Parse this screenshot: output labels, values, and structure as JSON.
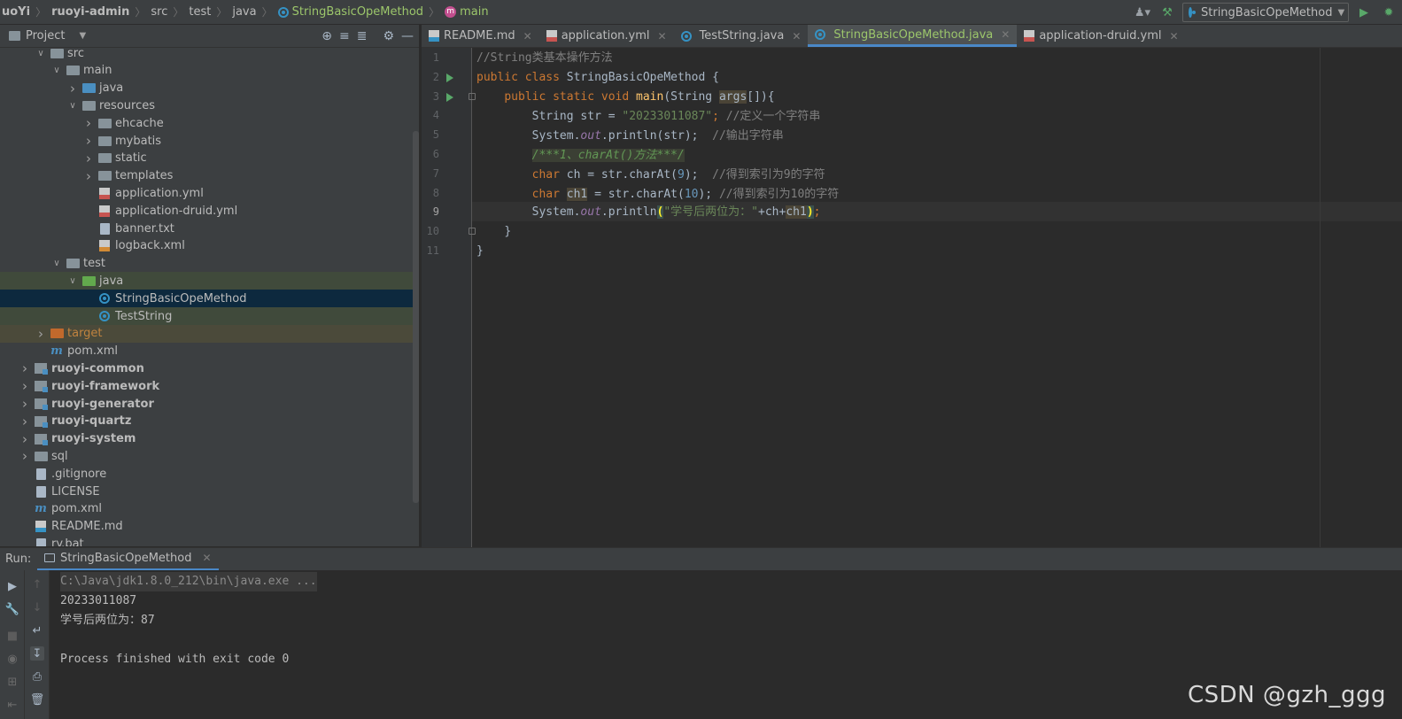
{
  "breadcrumb": {
    "items": [
      "uoYi",
      "ruoyi-admin",
      "src",
      "test",
      "java",
      "StringBasicOpeMethod",
      "main"
    ]
  },
  "toolbar": {
    "run_config": "StringBasicOpeMethod",
    "icons": [
      "user-icon",
      "hammer-icon",
      "run-icon",
      "debug-icon"
    ]
  },
  "project_panel": {
    "title": "Project",
    "tree": [
      {
        "label": "src",
        "depth": 2,
        "expanded": true,
        "icon": "folder"
      },
      {
        "label": "main",
        "depth": 3,
        "expanded": true,
        "icon": "folder"
      },
      {
        "label": "java",
        "depth": 4,
        "expanded": false,
        "icon": "folder-blue"
      },
      {
        "label": "resources",
        "depth": 4,
        "expanded": true,
        "icon": "folder-resources"
      },
      {
        "label": "ehcache",
        "depth": 5,
        "expanded": false,
        "icon": "folder"
      },
      {
        "label": "mybatis",
        "depth": 5,
        "expanded": false,
        "icon": "folder"
      },
      {
        "label": "static",
        "depth": 5,
        "expanded": false,
        "icon": "folder"
      },
      {
        "label": "templates",
        "depth": 5,
        "expanded": false,
        "icon": "folder"
      },
      {
        "label": "application.yml",
        "depth": 5,
        "icon": "yml"
      },
      {
        "label": "application-druid.yml",
        "depth": 5,
        "icon": "yml"
      },
      {
        "label": "banner.txt",
        "depth": 5,
        "icon": "file"
      },
      {
        "label": "logback.xml",
        "depth": 5,
        "icon": "xml"
      },
      {
        "label": "test",
        "depth": 3,
        "expanded": true,
        "icon": "folder"
      },
      {
        "label": "java",
        "depth": 4,
        "expanded": true,
        "icon": "folder-green"
      },
      {
        "label": "StringBasicOpeMethod",
        "depth": 5,
        "icon": "class"
      },
      {
        "label": "TestString",
        "depth": 5,
        "icon": "class"
      },
      {
        "label": "target",
        "depth": 2,
        "expanded": false,
        "icon": "folder-orange"
      },
      {
        "label": "pom.xml",
        "depth": 2,
        "icon": "maven"
      },
      {
        "label": "ruoyi-common",
        "depth": 1,
        "expanded": false,
        "icon": "module",
        "bold": true
      },
      {
        "label": "ruoyi-framework",
        "depth": 1,
        "expanded": false,
        "icon": "module",
        "bold": true
      },
      {
        "label": "ruoyi-generator",
        "depth": 1,
        "expanded": false,
        "icon": "module",
        "bold": true
      },
      {
        "label": "ruoyi-quartz",
        "depth": 1,
        "expanded": false,
        "icon": "module",
        "bold": true
      },
      {
        "label": "ruoyi-system",
        "depth": 1,
        "expanded": false,
        "icon": "module",
        "bold": true
      },
      {
        "label": "sql",
        "depth": 1,
        "expanded": false,
        "icon": "folder"
      },
      {
        "label": ".gitignore",
        "depth": 1,
        "icon": "file"
      },
      {
        "label": "LICENSE",
        "depth": 1,
        "icon": "file"
      },
      {
        "label": "pom.xml",
        "depth": 1,
        "icon": "maven"
      },
      {
        "label": "README.md",
        "depth": 1,
        "icon": "md"
      },
      {
        "label": "ry.bat",
        "depth": 1,
        "icon": "file"
      }
    ]
  },
  "editor_tabs": [
    {
      "label": "README.md",
      "icon": "md"
    },
    {
      "label": "application.yml",
      "icon": "yml"
    },
    {
      "label": "TestString.java",
      "icon": "class"
    },
    {
      "label": "StringBasicOpeMethod.java",
      "icon": "class",
      "active": true
    },
    {
      "label": "application-druid.yml",
      "icon": "yml"
    }
  ],
  "code": {
    "line_numbers": [
      "1",
      "2",
      "3",
      "4",
      "5",
      "6",
      "7",
      "8",
      "9",
      "10",
      "11"
    ],
    "current_line": "9",
    "l1_comment": "//String类基本操作方法",
    "l2_public": "public",
    "l2_class": "class",
    "l2_name": "StringBasicOpeMethod {",
    "l3_mods": "public static void",
    "l3_main": "main",
    "l3_open": "(String ",
    "l3_args": "args",
    "l3_rest": "[]){",
    "l4_type": "String str = ",
    "l4_str": "\"20233011087\"",
    "l4_semi": "; ",
    "l4_comment": "//定义一个字符串",
    "l5_sys": "System.",
    "l5_out": "out",
    "l5_call": ".println(str);  ",
    "l5_comment": "//输出字符串",
    "l6_doc": "/***1、charAt()方法***/",
    "l7_char": "char",
    "l7_mid": " ch = str.charAt(",
    "l7_num": "9",
    "l7_end": ");  ",
    "l7_comment": "//得到索引为9的字符",
    "l8_char": "char",
    "l8_var": "ch1",
    "l8_mid": " = str.charAt(",
    "l8_num": "10",
    "l8_end": "); ",
    "l8_comment": "//得到索引为10的字符",
    "l9_sys": "System.",
    "l9_out": "out",
    "l9_call": ".println",
    "l9_open": "(",
    "l9_str": "\"学号后两位为：\"",
    "l9_plus": "+ch+",
    "l9_var": "ch1",
    "l9_close": ")",
    "l9_semi": ";",
    "l10": "}",
    "l11": "}"
  },
  "run_panel": {
    "label": "Run:",
    "tab": "StringBasicOpeMethod",
    "console": [
      "C:\\Java\\jdk1.8.0_212\\bin\\java.exe ...",
      "20233011087",
      "学号后两位为：87",
      "",
      "Process finished with exit code 0"
    ]
  },
  "watermark": "CSDN @gzh_ggg"
}
